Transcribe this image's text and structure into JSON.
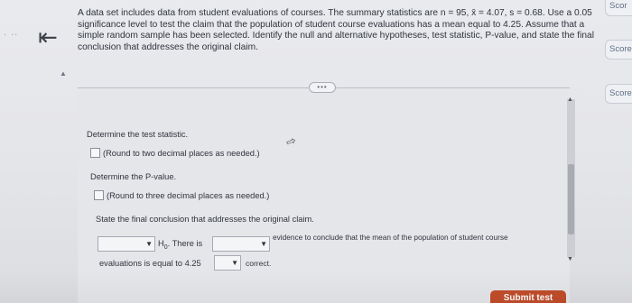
{
  "nav": {
    "dots": ". ..",
    "back_symbol": "⇤",
    "left_marker": "▲"
  },
  "question": {
    "text": "A data set includes data from student evaluations of courses. The summary statistics are n = 95, x̄ = 4.07, s = 0.68. Use a 0.05 significance level to test the claim that the population of student course evaluations has a mean equal to 4.25. Assume that a simple random sample has been selected. Identify the null and alternative hypotheses, test statistic, P-value, and state the final conclusion that addresses the original claim."
  },
  "expand_button": {
    "label": "•••"
  },
  "score_tabs": [
    "Scor",
    "Score",
    "Score"
  ],
  "answer": {
    "test_statistic": {
      "heading": "Determine the test statistic.",
      "hint": "(Round to two decimal places as needed.)"
    },
    "p_value": {
      "heading": "Determine the P-value.",
      "hint": "(Round to three decimal places as needed.)"
    },
    "conclusion": {
      "heading": "State the final conclusion that addresses the original claim.",
      "h0_label": "H",
      "h0_sub": "0",
      "text_there_is": ". There is",
      "text_evidence": "evidence to conclude that the mean of the population of student course",
      "text_evaluations": "evaluations is equal to 4.25",
      "text_correct": "correct."
    }
  },
  "dropdown_arrow": "▼",
  "cursor_glyph": "⇨",
  "submit": {
    "label": "Submit test"
  }
}
